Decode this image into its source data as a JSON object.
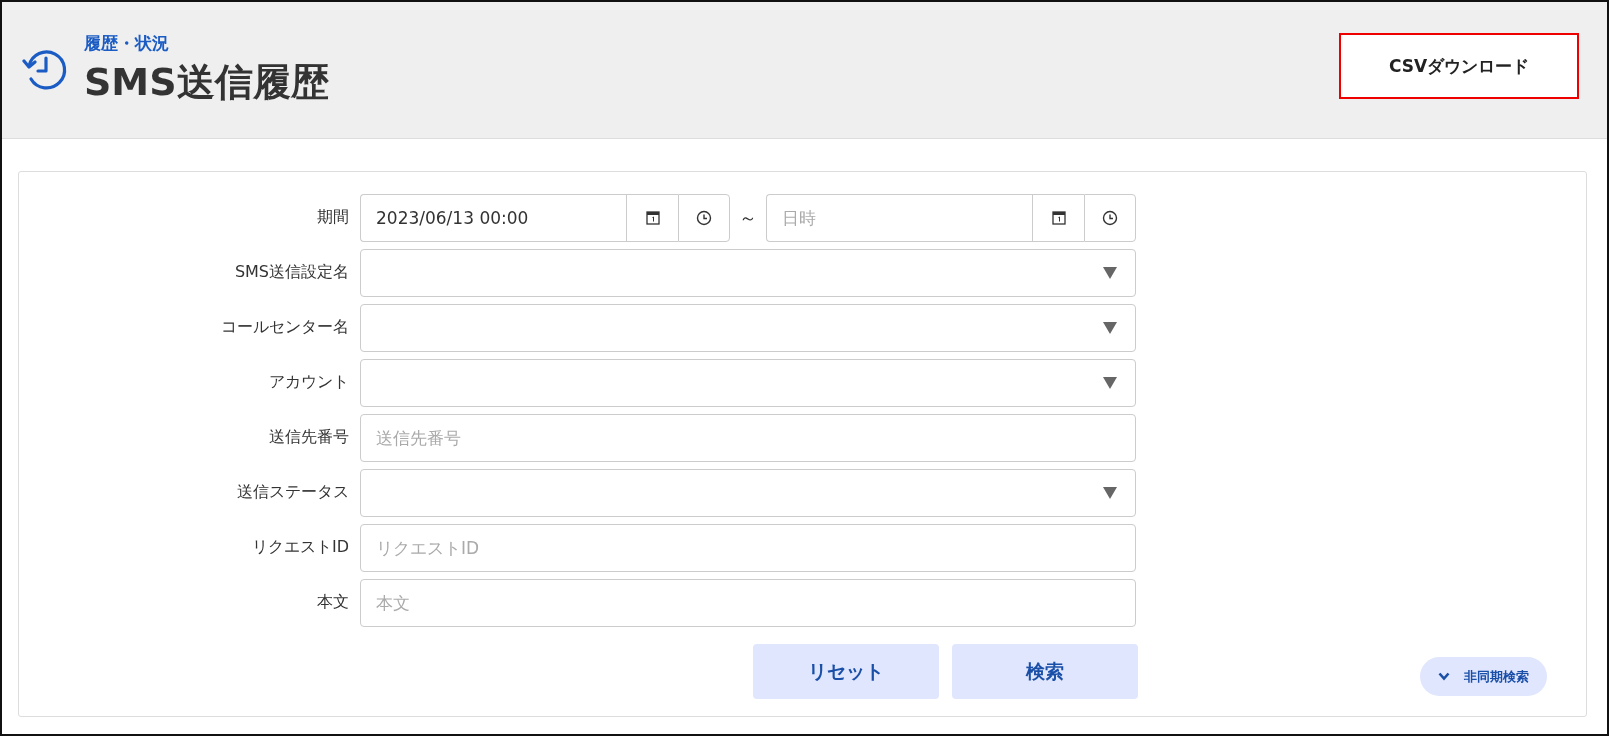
{
  "header": {
    "breadcrumb": "履歴・状況",
    "title": "SMS送信履歴",
    "csv_button": "CSVダウンロード"
  },
  "fields": [
    {
      "label": "期間",
      "kind": "date_range",
      "from": {
        "value": "2023/06/13 00:00"
      },
      "separator": "～",
      "to": {
        "placeholder": "日時"
      }
    },
    {
      "label": "SMS送信設定名",
      "kind": "select"
    },
    {
      "label": "コールセンター名",
      "kind": "select"
    },
    {
      "label": "アカウント",
      "kind": "select"
    },
    {
      "label": "送信先番号",
      "kind": "text",
      "placeholder": "送信先番号"
    },
    {
      "label": "送信ステータス",
      "kind": "select"
    },
    {
      "label": "リクエストID",
      "kind": "text",
      "placeholder": "リクエストID"
    },
    {
      "label": "本文",
      "kind": "text",
      "placeholder": "本文"
    }
  ],
  "buttons": [
    "リセット",
    "検索"
  ],
  "async_search": "非同期検索"
}
